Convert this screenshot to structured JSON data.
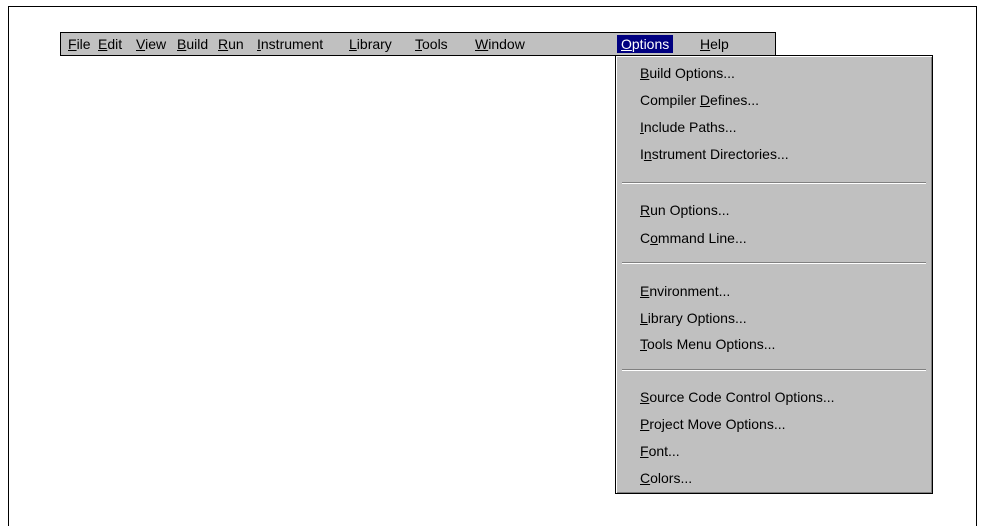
{
  "menubar": {
    "items": [
      {
        "label": "File",
        "accel_index": 0
      },
      {
        "label": "Edit",
        "accel_index": 0
      },
      {
        "label": "View",
        "accel_index": 0
      },
      {
        "label": "Build",
        "accel_index": 0
      },
      {
        "label": "Run",
        "accel_index": 0
      },
      {
        "label": "Instrument",
        "accel_index": 0
      },
      {
        "label": "Library",
        "accel_index": 0
      },
      {
        "label": "Tools",
        "accel_index": 0
      },
      {
        "label": "Window",
        "accel_index": 0
      },
      {
        "label": "Options",
        "accel_index": 0,
        "active": true
      },
      {
        "label": "Help",
        "accel_index": 0
      }
    ]
  },
  "options_menu": {
    "groups": [
      [
        {
          "label": "Build Options...",
          "accel_index": 0
        },
        {
          "label": "Compiler Defines...",
          "accel_index": 9
        },
        {
          "label": "Include Paths...",
          "accel_index": 0
        },
        {
          "label": "Instrument Directories...",
          "accel_index": 1
        }
      ],
      [
        {
          "label": "Run Options...",
          "accel_index": 0
        },
        {
          "label": "Command Line...",
          "accel_index": 1
        }
      ],
      [
        {
          "label": "Environment...",
          "accel_index": 0
        },
        {
          "label": "Library Options...",
          "accel_index": 0
        },
        {
          "label": "Tools Menu Options...",
          "accel_index": 0
        }
      ],
      [
        {
          "label": "Source Code Control Options...",
          "accel_index": 0
        },
        {
          "label": "Project Move Options...",
          "accel_index": 0
        },
        {
          "label": "Font...",
          "accel_index": 0
        },
        {
          "label": "Colors...",
          "accel_index": 0
        }
      ]
    ]
  },
  "colors": {
    "menu_bg": "#c0c0c0",
    "highlight_bg": "#000080",
    "highlight_fg": "#ffffff"
  }
}
